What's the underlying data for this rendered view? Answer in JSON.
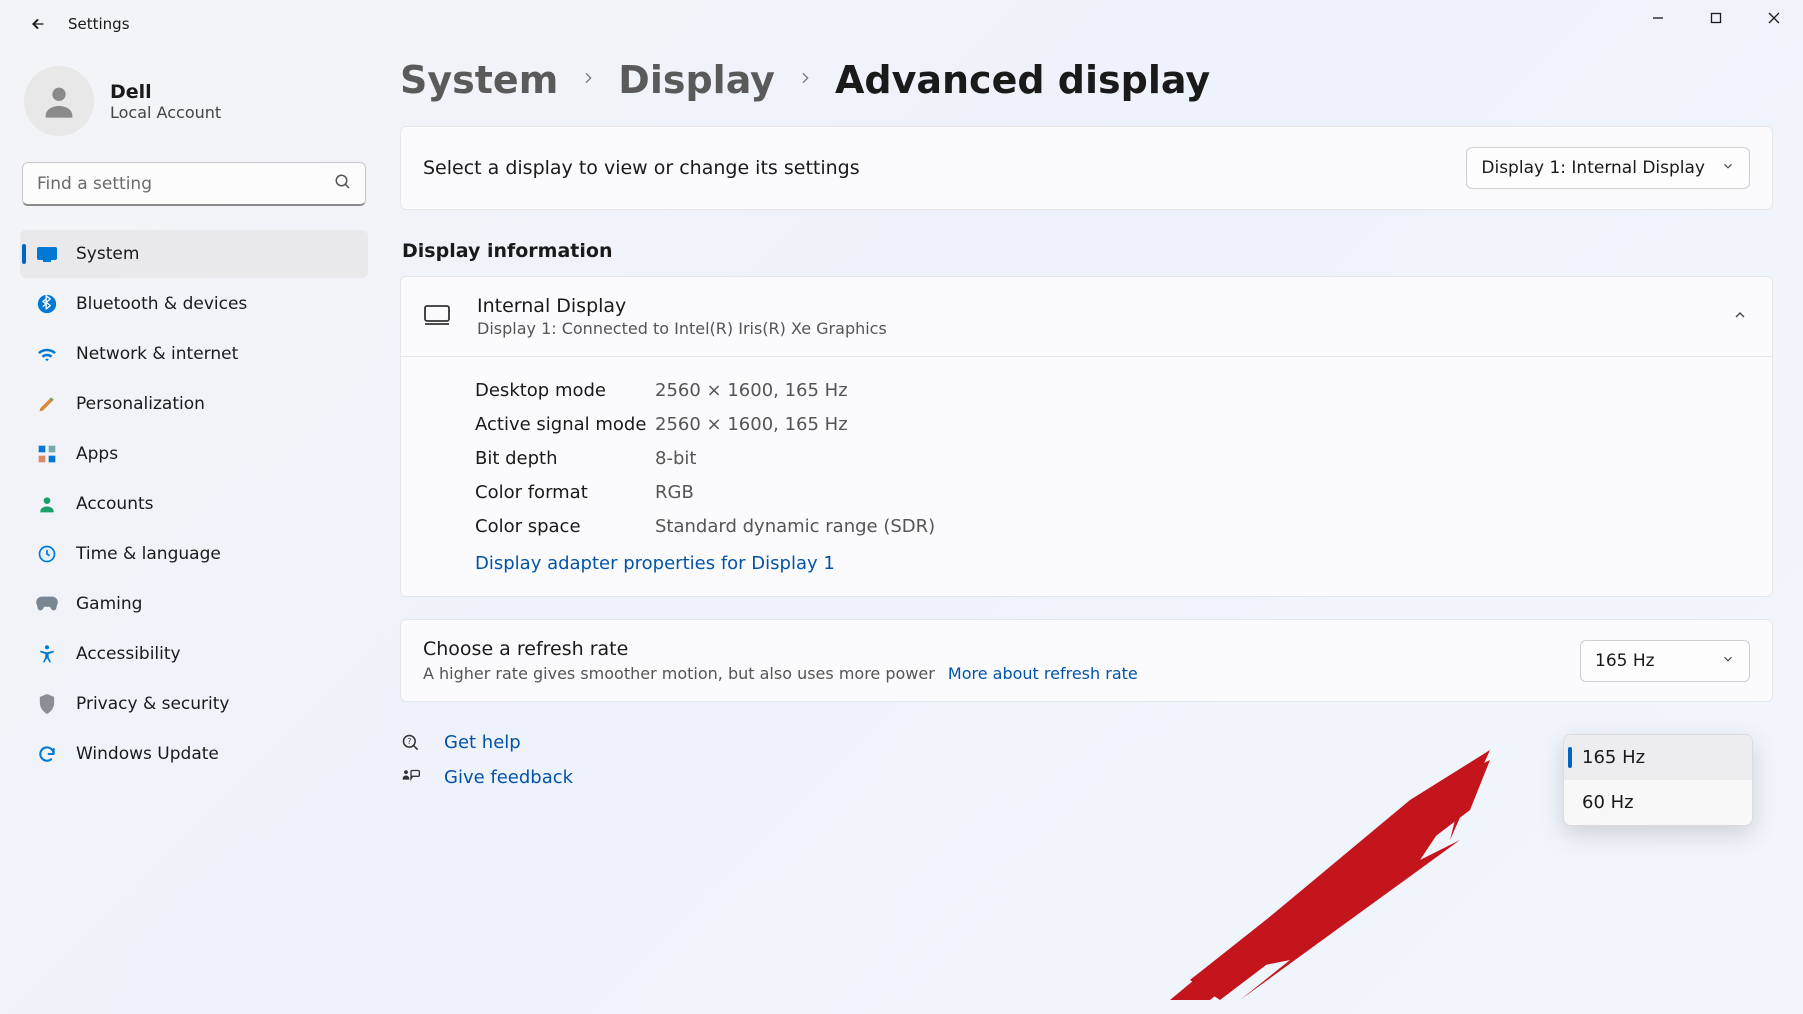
{
  "window": {
    "title": "Settings"
  },
  "user": {
    "name": "Dell",
    "subtitle": "Local Account"
  },
  "search": {
    "placeholder": "Find a setting"
  },
  "sidebar": {
    "items": [
      {
        "label": "System"
      },
      {
        "label": "Bluetooth & devices"
      },
      {
        "label": "Network & internet"
      },
      {
        "label": "Personalization"
      },
      {
        "label": "Apps"
      },
      {
        "label": "Accounts"
      },
      {
        "label": "Time & language"
      },
      {
        "label": "Gaming"
      },
      {
        "label": "Accessibility"
      },
      {
        "label": "Privacy & security"
      },
      {
        "label": "Windows Update"
      }
    ]
  },
  "breadcrumb": {
    "a": "System",
    "b": "Display",
    "current": "Advanced display"
  },
  "select_display": {
    "label": "Select a display to view or change its settings",
    "value": "Display 1: Internal Display"
  },
  "section_title": "Display information",
  "display": {
    "title": "Internal Display",
    "subtitle": "Display 1: Connected to Intel(R) Iris(R) Xe Graphics",
    "rows": [
      {
        "k": "Desktop mode",
        "v": "2560 × 1600, 165 Hz"
      },
      {
        "k": "Active signal mode",
        "v": "2560 × 1600, 165 Hz"
      },
      {
        "k": "Bit depth",
        "v": "8-bit"
      },
      {
        "k": "Color format",
        "v": "RGB"
      },
      {
        "k": "Color space",
        "v": "Standard dynamic range (SDR)"
      }
    ],
    "adapter_link": "Display adapter properties for Display 1"
  },
  "refresh": {
    "title": "Choose a refresh rate",
    "subtitle": "A higher rate gives smoother motion, but also uses more power",
    "more_link": "More about refresh rate",
    "options": [
      {
        "label": "165 Hz",
        "selected": true
      },
      {
        "label": "60 Hz",
        "selected": false
      }
    ]
  },
  "help": {
    "get_help": "Get help",
    "give_feedback": "Give feedback"
  }
}
